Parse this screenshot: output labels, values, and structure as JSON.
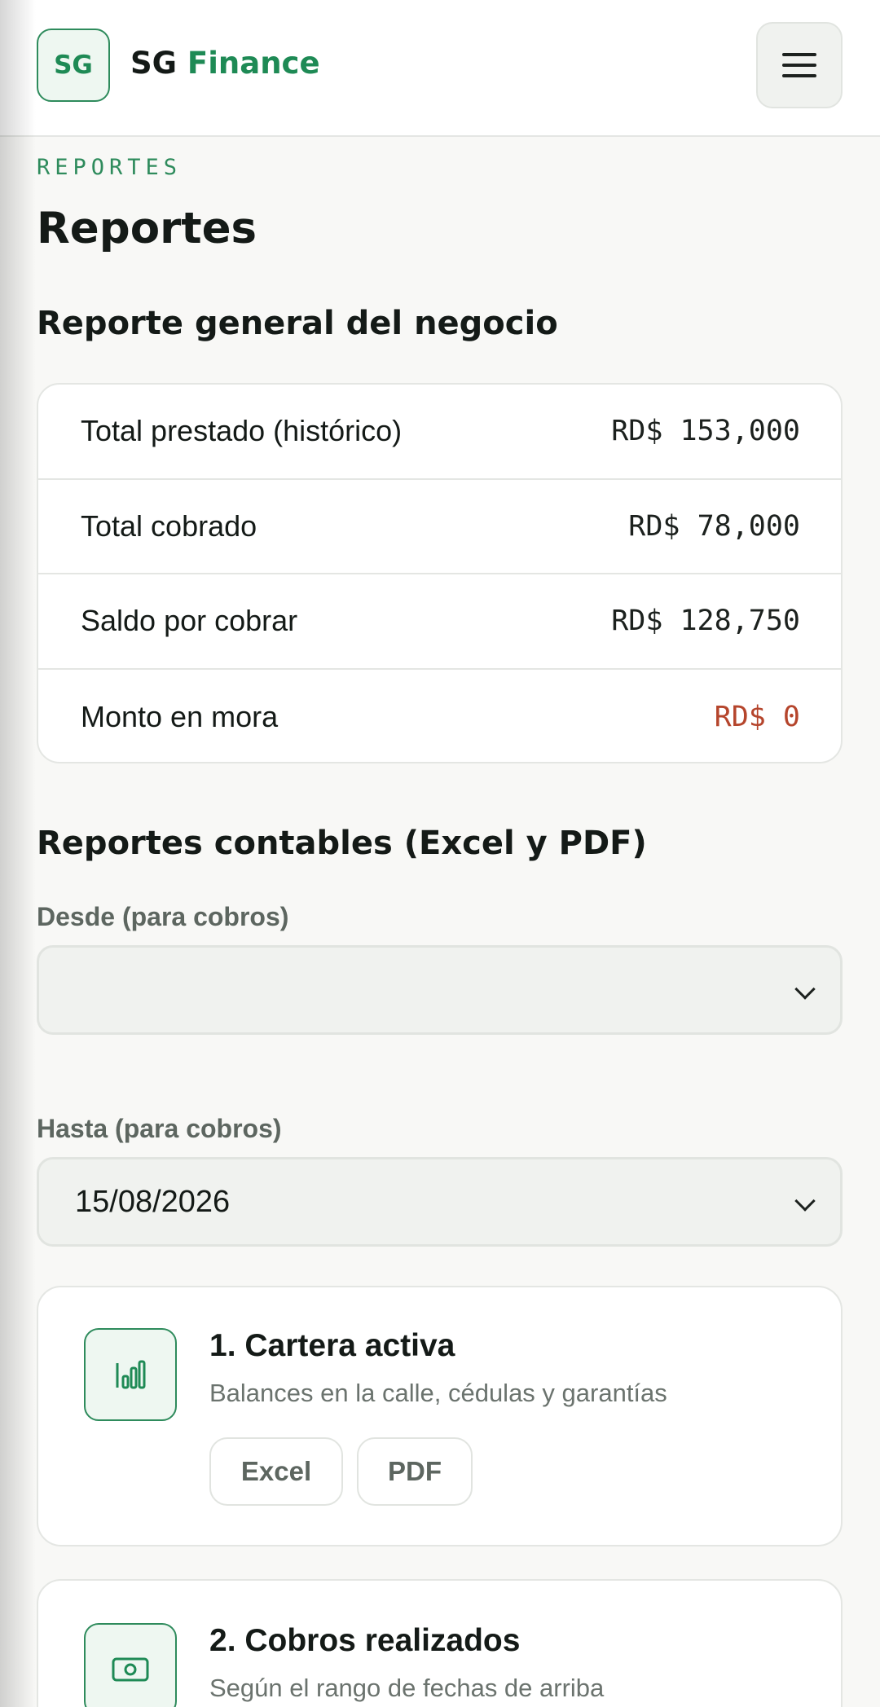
{
  "header": {
    "logo_text": "SG",
    "brand_primary": "SG",
    "brand_accent": "Finance",
    "menu_icon": "hamburger-menu-icon"
  },
  "breadcrumb": "REPORTES",
  "page_title": "Reportes",
  "general": {
    "title": "Reporte general del negocio",
    "rows": [
      {
        "label": "Total prestado (histórico)",
        "value": "RD$ 153,000"
      },
      {
        "label": "Total cobrado",
        "value": "RD$ 78,000"
      },
      {
        "label": "Saldo por cobrar",
        "value": "RD$ 128,750"
      },
      {
        "label": "Monto en mora",
        "value": "RD$ 0",
        "status": "danger"
      }
    ]
  },
  "accounting": {
    "title": "Reportes contables (Excel y PDF)",
    "from_label": "Desde (para cobros)",
    "from_value": "",
    "to_label": "Hasta (para cobros)",
    "to_value": "15/08/2026"
  },
  "reports": [
    {
      "title": "1. Cartera activa",
      "description": "Balances en la calle, cédulas y garantías",
      "icon": "bar-chart-icon",
      "excel_label": "Excel",
      "pdf_label": "PDF"
    },
    {
      "title": "2. Cobros realizados",
      "description": "Según el rango de fechas de arriba",
      "icon": "cash-icon"
    }
  ],
  "colors": {
    "accent": "#1e8a55",
    "danger": "#b5452c",
    "background": "#f8f8f6"
  }
}
